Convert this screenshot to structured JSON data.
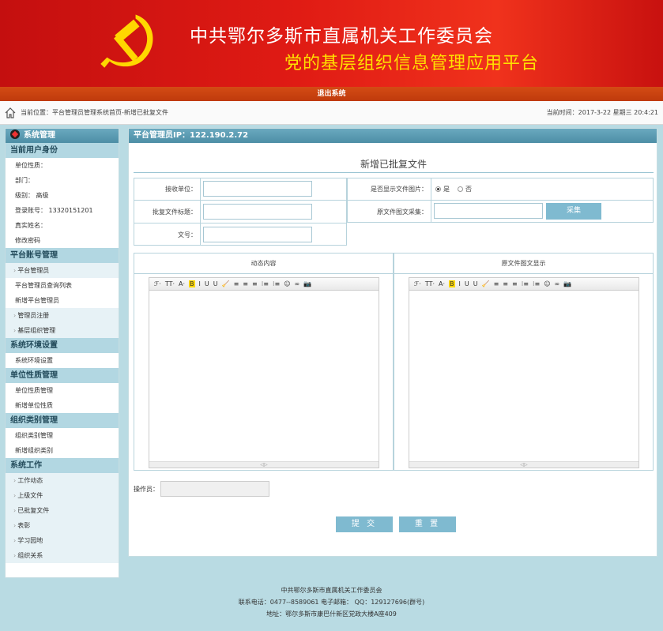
{
  "header": {
    "title_line1": "中共鄂尔多斯市直属机关工作委员会",
    "title_line2": "党的基层组织信息管理应用平台",
    "emblem_icon": "hammer-sickle-icon",
    "logout_label": "退出系统"
  },
  "location": {
    "label": "当前位置：平台管理员管理系统首页-新增已批复文件",
    "time_label": "当前时间：2017-3-22 星期三 20:4:21"
  },
  "sidebar": {
    "top_label": "系统管理",
    "user_section": "当前用户身份",
    "user_fields": [
      "单位性质：",
      "部门：",
      "级别：  高级",
      "登录账号：  13320151201",
      "真实姓名：",
      "修改密码"
    ],
    "sections": [
      {
        "title": "平台账号管理",
        "items": [
          {
            "label": "平台管理员",
            "bullet": true,
            "blue": true
          },
          {
            "label": "平台管理员查询列表",
            "bullet": false,
            "blue": false
          },
          {
            "label": "新增平台管理员",
            "bullet": false,
            "blue": false
          },
          {
            "label": "管理员注册",
            "bullet": true,
            "blue": true
          },
          {
            "label": "基层组织管理",
            "bullet": true,
            "blue": true
          }
        ]
      },
      {
        "title": "系统环境设置",
        "items": [
          {
            "label": "系统环境设置",
            "bullet": false,
            "blue": false
          }
        ]
      },
      {
        "title": "单位性质管理",
        "items": [
          {
            "label": "单位性质管理",
            "bullet": false,
            "blue": false
          },
          {
            "label": "新增单位性质",
            "bullet": false,
            "blue": false
          }
        ]
      },
      {
        "title": "组织类别管理",
        "items": [
          {
            "label": "组织类别管理",
            "bullet": false,
            "blue": false
          },
          {
            "label": "新增组织类别",
            "bullet": false,
            "blue": false
          }
        ]
      },
      {
        "title": "系统工作",
        "items": [
          {
            "label": "工作动态",
            "bullet": true,
            "blue": true
          },
          {
            "label": "上级文件",
            "bullet": true,
            "blue": true
          },
          {
            "label": "已批复文件",
            "bullet": true,
            "blue": true
          },
          {
            "label": "表彰",
            "bullet": true,
            "blue": true
          },
          {
            "label": "学习园地",
            "bullet": true,
            "blue": true
          },
          {
            "label": "组织关系",
            "bullet": true,
            "blue": true
          }
        ]
      }
    ]
  },
  "main": {
    "header": "平台管理员IP：122.190.2.72",
    "form_title": "新增已批复文件",
    "fields": {
      "receiver_label": "接收单位：",
      "title_label": "批复文件标题：",
      "docno_label": "文号：",
      "show_image_label": "是否显示文件图片：",
      "yes_label": "是",
      "no_label": "否",
      "capture_label": "原文件图文采集：",
      "capture_button": "采集"
    },
    "editor_left_title": "动态内容",
    "editor_right_title": "原文件图文显示",
    "toolbar": [
      "ℱ·",
      "TT·",
      "A·",
      "B",
      "I",
      "U",
      "U",
      "🧹",
      "≡",
      "≡",
      "≡",
      "⁝≡",
      "⁝≡",
      "☺",
      "∞",
      "📷"
    ],
    "operator_label": "操作员：",
    "submit_label": "提 交",
    "reset_label": "重 置"
  },
  "footer": {
    "line1": "中共鄂尔多斯市直属机关工作委员会",
    "line2": "联系电话：0477--8589061        电子邮箱：        QQ：129127696(群号)",
    "line3": "地址：鄂尔多斯市康巴什新区党政大楼A座409"
  },
  "colors": {
    "header_red": "#d8170f",
    "title_yellow": "#ffe000",
    "accent_blue": "#7fbad0"
  }
}
